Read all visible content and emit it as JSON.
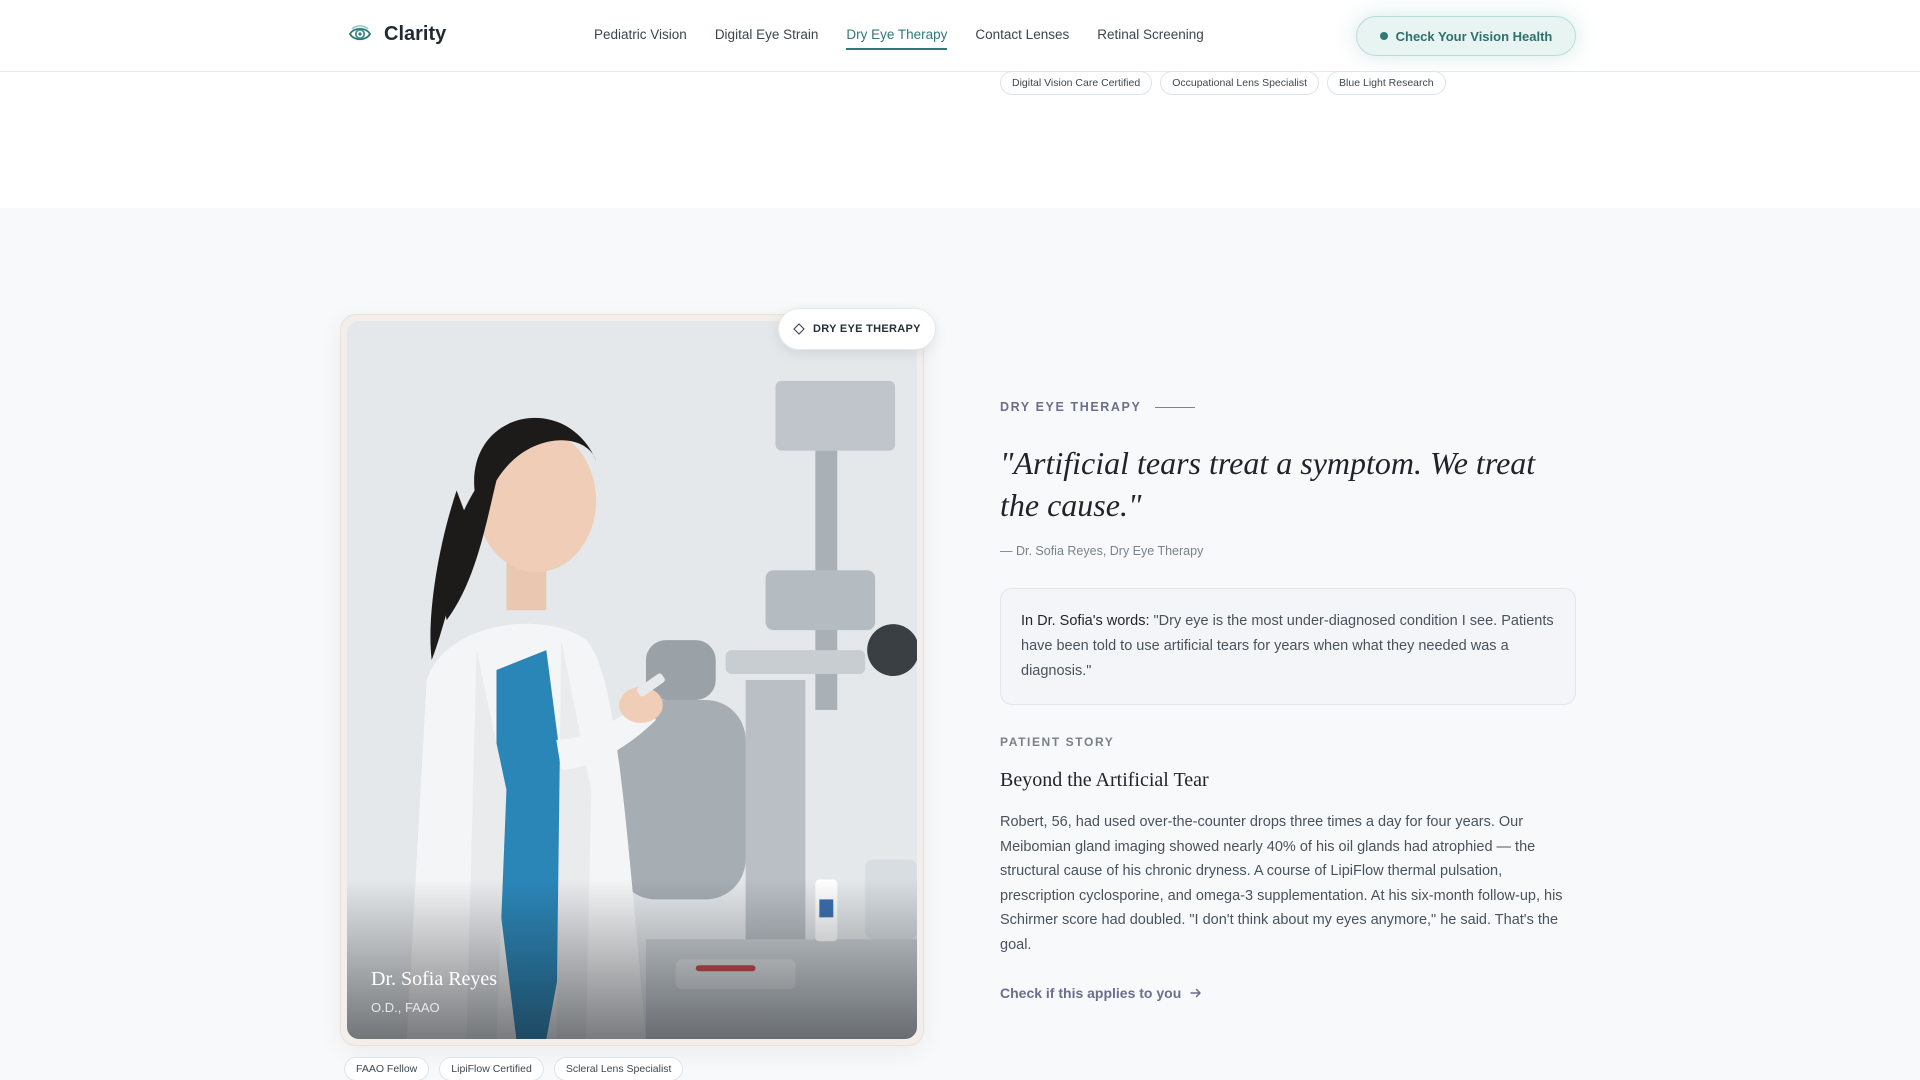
{
  "brand": {
    "name": "Clarity",
    "icon": "eye-logo-icon"
  },
  "nav": {
    "items": [
      {
        "label": "Pediatric Vision",
        "active": false
      },
      {
        "label": "Digital Eye Strain",
        "active": false
      },
      {
        "label": "Dry Eye Therapy",
        "active": true
      },
      {
        "label": "Contact Lenses",
        "active": false
      },
      {
        "label": "Retinal Screening",
        "active": false
      }
    ],
    "cta_label": "Check Your Vision Health"
  },
  "previous_section": {
    "tags": [
      "Digital Vision Care Certified",
      "Occupational Lens Specialist",
      "Blue Light Research"
    ]
  },
  "doctor_card": {
    "badge": "DRY EYE THERAPY",
    "name": "Dr. Sofia Reyes",
    "credentials": "O.D., FAAO",
    "tags": [
      "FAAO Fellow",
      "LipiFlow Certified",
      "Scleral Lens Specialist"
    ]
  },
  "content": {
    "eyebrow": "DRY EYE THERAPY",
    "quote": "\"Artificial tears treat a symptom. We treat the cause.\"",
    "attribution": "— Dr. Sofia Reyes, Dry Eye Therapy",
    "words_lead": "In Dr. Sofia's words:",
    "words_text": " \"Dry eye is the most under-diagnosed condition I see. Patients have been told to use artificial tears for years when what they needed was a diagnosis.\"",
    "story_eyebrow": "PATIENT STORY",
    "story_title": "Beyond the Artificial Tear",
    "story_body": "Robert, 56, had used over-the-counter drops three times a day for four years. Our Meibomian gland imaging showed nearly 40% of his oil glands had atrophied — the structural cause of his chronic dryness. A course of LipiFlow thermal pulsation, prescription cyclosporine, and omega-3 supplementation. At his six-month follow-up, his Schirmer score had doubled. \"I don't think about my eyes anymore,\" he said. That's the goal.",
    "link_label": "Check if this applies to you"
  },
  "colors": {
    "accent": "#2f7a78",
    "eyebrow": "#6b6f8a",
    "background": "#f7f9fb"
  }
}
